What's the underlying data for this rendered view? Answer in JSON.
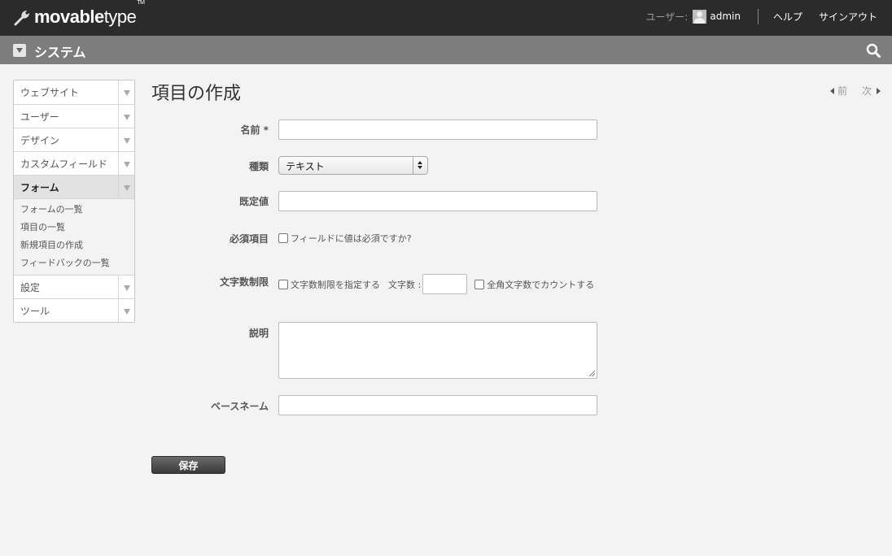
{
  "app": {
    "logo": {
      "bold": "movable",
      "light": "type",
      "tm": "TM"
    }
  },
  "header": {
    "user_label": "ユーザー:",
    "username": "admin",
    "help_label": "ヘルプ",
    "signout_label": "サインアウト"
  },
  "scope": {
    "title": "システム"
  },
  "sidebar": {
    "items": [
      {
        "label": "ウェブサイト"
      },
      {
        "label": "ユーザー"
      },
      {
        "label": "デザイン"
      },
      {
        "label": "カスタムフィールド"
      },
      {
        "label": "フォーム",
        "active": true
      },
      {
        "label": "設定"
      },
      {
        "label": "ツール"
      }
    ],
    "submenu": [
      {
        "label": "フォームの一覧"
      },
      {
        "label": "項目の一覧"
      },
      {
        "label": "新規項目の作成"
      },
      {
        "label": "フィードバックの一覧"
      }
    ]
  },
  "page": {
    "title": "項目の作成",
    "prev_label": "前",
    "next_label": "次"
  },
  "form": {
    "name_label": "名前 *",
    "name_value": "",
    "type_label": "種類",
    "type_value": "テキスト",
    "default_label": "既定値",
    "default_value": "",
    "required_label": "必須項目",
    "required_checkbox_label": "フィールドに値は必須ですか?",
    "charlimit_label": "文字数制限",
    "charlimit_checkbox_label": "文字数制限を指定する",
    "charcount_label": "文字数 :",
    "charcount_value": "",
    "fullwidth_checkbox_label": "全角文字数でカウントする",
    "description_label": "説明",
    "description_value": "",
    "basename_label": "ベースネーム",
    "basename_value": "",
    "save_label": "保存"
  }
}
